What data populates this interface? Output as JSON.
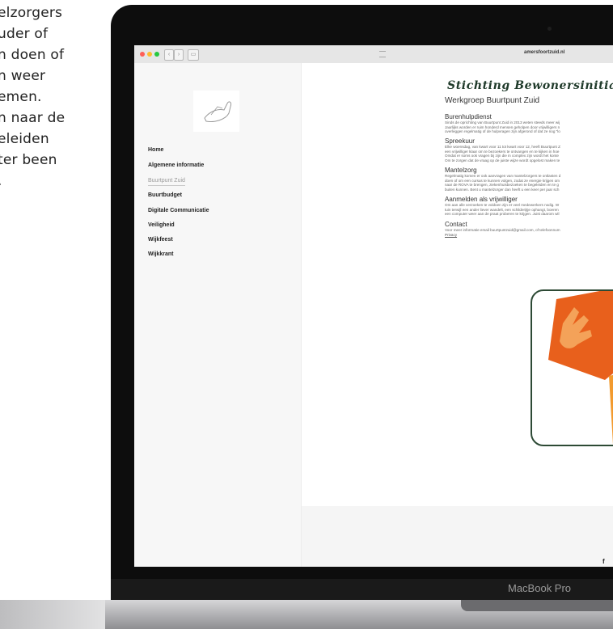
{
  "background_text": [
    "elzorgers",
    "uder of",
    "n doen of",
    "n weer",
    "emen.",
    "n naar de",
    "eleiden",
    " ter been",
    "."
  ],
  "browser": {
    "url": "amersfoortzuid.nl"
  },
  "sidebar": {
    "items": [
      {
        "label": "Home"
      },
      {
        "label": "Algemene informatie"
      },
      {
        "label": "Buurtpunt Zuid",
        "active": true
      },
      {
        "label": "Buurtbudget"
      },
      {
        "label": "Digitale Communicatie"
      },
      {
        "label": "Veiligheid"
      },
      {
        "label": "Wijkfeest"
      },
      {
        "label": "Wijkkrant"
      }
    ]
  },
  "content": {
    "title": "Stichting Bewonersinitia",
    "subtitle": "Werkgroep Buurtpunt Zuid",
    "sections": [
      {
        "heading": "Burenhulpdienst",
        "lines": [
          "Sinds de oprichting van Buurtpunt Zuid in 2013 weten steeds meer wij",
          "Jaarlijks worden er ruim honderd mensen geholpen door vrijwilligers n",
          "overleggen regelmatig of de hulpvragen zijn afgerond of dat ze nog \"lo"
        ]
      },
      {
        "heading": "Spreekuur",
        "lines": [
          "Elke woensdag, van kwart voor 11 tot kwart voor 12, heeft Buurtpunt Z",
          "een vrijwilliger klaar om te bezoekers te ontvangen en te kijken in hoe",
          "Omdat er soms ook vragen bij zijn die in complex zijn wordt het konte",
          "Om te zorgen dat de vraag op de juiste wijze wordt opgelost maken te"
        ]
      },
      {
        "heading": "Mantelzorg",
        "lines": [
          "Regelmatig komen er ook aanvragen van mantelzorgers te ontlasten d",
          "doen of om een cursus te kunnen volgen, zodat ze energie krijgen om",
          "naar de ROVA te brengen, ziekenhuisbezoeken te begeleiden en te g",
          "buiten kunnen. Bent u mantelzorger dan heeft u een keer per jaar sch"
        ]
      },
      {
        "heading": "Aanmelden als vrijwilliger",
        "lines": [
          "Om aan alle verzoeken te voldoen zijn er veel medewerkers nodig. W",
          "tuin terwijl een ander liever wandelt, een schilderijtje ophangt, boeren",
          "een computer weer aan de praat proberen te krijgen. Juist daarom wil"
        ]
      },
      {
        "heading": "Contact",
        "lines": [
          "Voor meer informatie email buurtpuntzuid@gmail.com, of telefoonnum"
        ],
        "link": "Privacy"
      }
    ],
    "footer_icon": "facebook-icon",
    "footer_label": "f"
  },
  "laptop": {
    "brand": "MacBook Pro"
  },
  "colors": {
    "title": "#1f3a2a",
    "card_border": "#2d4a35",
    "logo_orange": "#e8601c"
  }
}
